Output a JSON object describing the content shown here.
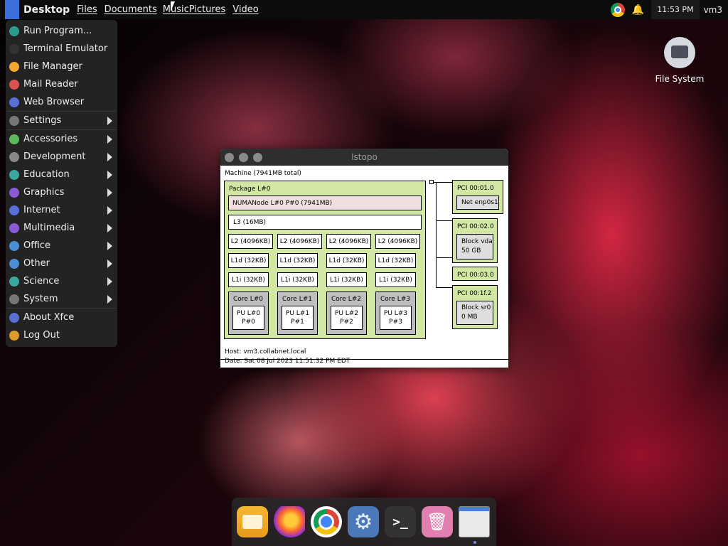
{
  "top_panel": {
    "desktop_label": "Desktop",
    "menus": [
      "Files",
      "Documents",
      "Music",
      "Pictures",
      "Video"
    ],
    "clock": "11:53 PM",
    "user": "vm3"
  },
  "app_menu": {
    "items": [
      {
        "label": "Run Program...",
        "icon": "run-icon",
        "color": "#2a9d8f",
        "submenu": false
      },
      {
        "label": "Terminal Emulator",
        "icon": "terminal-icon",
        "color": "#333333",
        "submenu": false
      },
      {
        "label": "File Manager",
        "icon": "folder-icon",
        "color": "#f0a830",
        "submenu": false
      },
      {
        "label": "Mail Reader",
        "icon": "mail-icon",
        "color": "#d9534f",
        "submenu": false
      },
      {
        "label": "Web Browser",
        "icon": "browser-icon",
        "color": "#5a6fd6",
        "submenu": false
      },
      {
        "label": "Settings",
        "icon": "settings-icon",
        "color": "#777777",
        "submenu": true
      },
      {
        "label": "Accessories",
        "icon": "accessories-icon",
        "color": "#5cb85c",
        "submenu": true
      },
      {
        "label": "Development",
        "icon": "development-icon",
        "color": "#888888",
        "submenu": true
      },
      {
        "label": "Education",
        "icon": "education-icon",
        "color": "#3aa8a0",
        "submenu": true
      },
      {
        "label": "Graphics",
        "icon": "graphics-icon",
        "color": "#8a5ad6",
        "submenu": true
      },
      {
        "label": "Internet",
        "icon": "internet-icon",
        "color": "#5a6fd6",
        "submenu": true
      },
      {
        "label": "Multimedia",
        "icon": "multimedia-icon",
        "color": "#8a5ad6",
        "submenu": true
      },
      {
        "label": "Office",
        "icon": "office-icon",
        "color": "#4a8fd6",
        "submenu": true
      },
      {
        "label": "Other",
        "icon": "other-icon",
        "color": "#4a8fd6",
        "submenu": true
      },
      {
        "label": "Science",
        "icon": "science-icon",
        "color": "#3aa8a0",
        "submenu": true
      },
      {
        "label": "System",
        "icon": "system-icon",
        "color": "#777777",
        "submenu": true
      },
      {
        "label": "About Xfce",
        "icon": "about-icon",
        "color": "#5a6fd6",
        "submenu": false
      },
      {
        "label": "Log Out",
        "icon": "logout-icon",
        "color": "#e09a2a",
        "submenu": false
      }
    ]
  },
  "desktop_icon": {
    "label": "File System"
  },
  "window": {
    "title": "lstopo",
    "machine": "Machine (7941MB total)",
    "package": "Package L#0",
    "numa": "NUMANode L#0 P#0 (7941MB)",
    "l3": "L3 (16MB)",
    "l2": [
      "L2 (4096KB)",
      "L2 (4096KB)",
      "L2 (4096KB)",
      "L2 (4096KB)"
    ],
    "l1d": [
      "L1d (32KB)",
      "L1d (32KB)",
      "L1d (32KB)",
      "L1d (32KB)"
    ],
    "l1i": [
      "L1i (32KB)",
      "L1i (32KB)",
      "L1i (32KB)",
      "L1i (32KB)"
    ],
    "cores": [
      "Core L#0",
      "Core L#1",
      "Core L#2",
      "Core L#3"
    ],
    "pus": [
      [
        "PU L#0",
        "P#0"
      ],
      [
        "PU L#1",
        "P#1"
      ],
      [
        "PU L#2",
        "P#2"
      ],
      [
        "PU L#3",
        "P#3"
      ]
    ],
    "pci": [
      {
        "label": "PCI 00:01.0",
        "device": [
          "Net enp0s1"
        ]
      },
      {
        "label": "PCI 00:02.0",
        "device": [
          "Block vda",
          "50 GB"
        ]
      },
      {
        "label": "PCI 00:03.0",
        "device": []
      },
      {
        "label": "PCI 00:1f.2",
        "device": [
          "Block sr0",
          "0 MB"
        ]
      }
    ],
    "host": "Host: vm3.collabnet.local",
    "date": "Date: Sat 08 Jul 2023 11:51:32 PM EDT"
  },
  "dock": {
    "items": [
      "files-icon",
      "firefox-icon",
      "chrome-icon",
      "settings-icon",
      "terminal-icon",
      "trash-icon",
      "window-icon"
    ]
  }
}
